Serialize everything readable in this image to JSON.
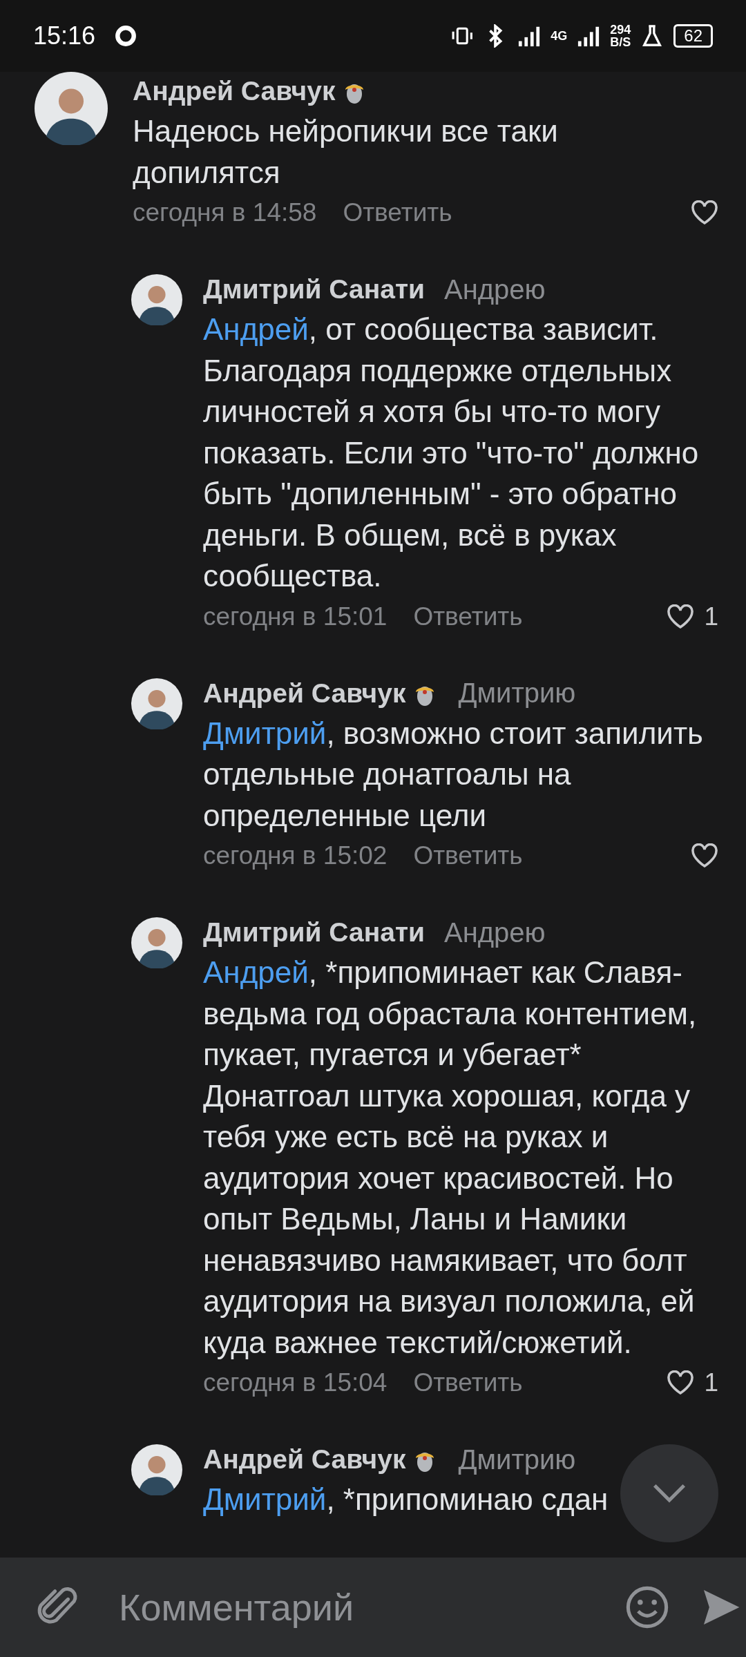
{
  "status_bar": {
    "time": "15:16",
    "network": "4G",
    "speed": "294",
    "speed_unit": "B/S",
    "battery": "62"
  },
  "comments": [
    {
      "author": "Андрей Савчук",
      "badge": true,
      "text": "Надеюсь нейропикчи все таки допилятся",
      "time": "сегодня в 14:58",
      "reply_label": "Ответить",
      "liked": false,
      "children": [
        {
          "author": "Дмитрий Санати",
          "badge": false,
          "reply_to": "Андрею",
          "mention": "Андрей",
          "text": ", от сообщества зависит. Благодаря поддержке отдельных личностей я хотя бы что-то могу показать. Если это \"что-то\" должно быть \"допиленным\" - это обратно деньги. В общем, всё в руках сообщества.",
          "time": "сегодня в 15:01",
          "reply_label": "Ответить",
          "liked": false,
          "likes": "1"
        },
        {
          "author": "Андрей Савчук",
          "badge": true,
          "reply_to": "Дмитрию",
          "mention": "Дмитрий",
          "text": ", возможно стоит запилить отдельные донатгоалы на определенные цели",
          "time": "сегодня в 15:02",
          "reply_label": "Ответить",
          "liked": false
        },
        {
          "author": "Дмитрий Санати",
          "badge": false,
          "reply_to": "Андрею",
          "mention": "Андрей",
          "text": ", *припоминает как Славя-ведьма год обрастала контентием, пукает, пугается и убегает* Донатгоал штука хорошая, когда у тебя уже есть всё на руках и аудитория хочет красивостей. Но опыт Ведьмы, Ланы и Намики ненавязчиво намякивает, что болт аудитория на визуал положила, ей куда важнее текстий/сюжетий.",
          "time": "сегодня в 15:04",
          "reply_label": "Ответить",
          "liked": false,
          "likes": "1"
        },
        {
          "author": "Андрей Савчук",
          "badge": true,
          "reply_to": "Дмитрию",
          "mention": "Дмитрий",
          "text": ", *припоминаю сдан"
        }
      ]
    }
  ],
  "composer": {
    "placeholder": "Комментарий"
  }
}
